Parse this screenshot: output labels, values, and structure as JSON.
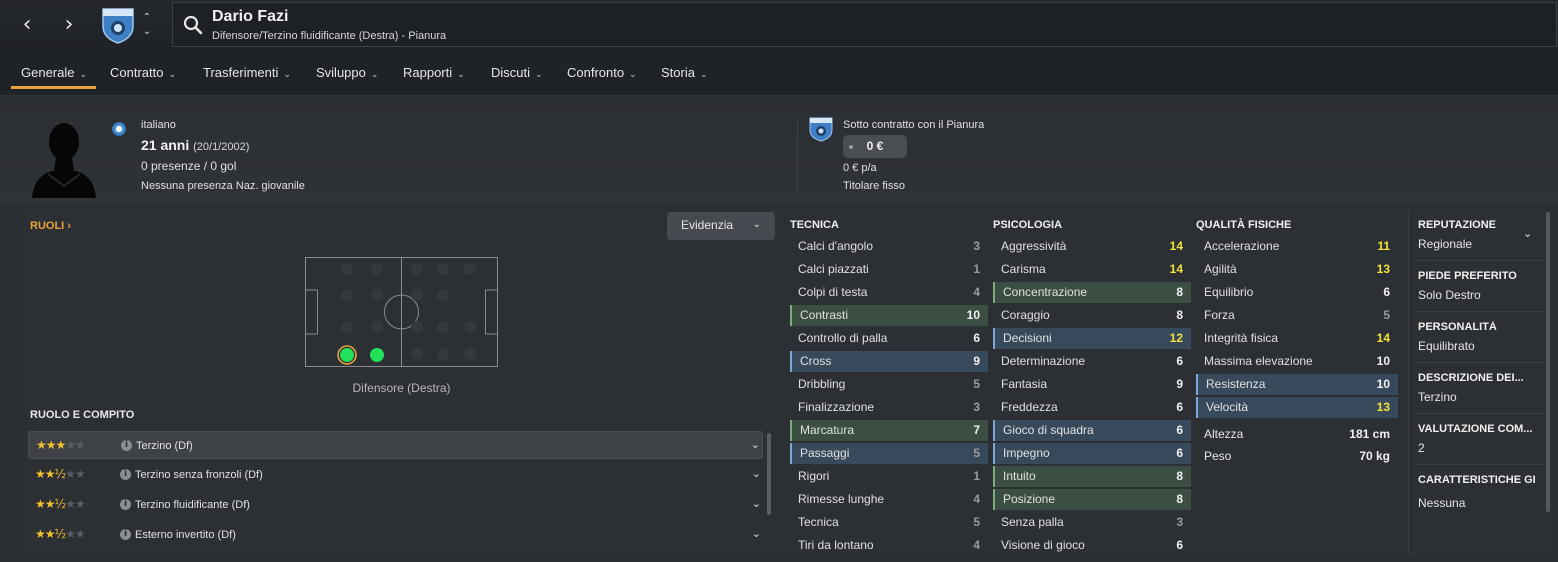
{
  "header": {
    "player_name": "Dario Fazi",
    "subtitle": "Difensore/Terzino fluidificante (Destra) - Pianura",
    "back_icon": "‹",
    "forward_icon": "›",
    "up_icon": "⌃",
    "down_icon": "⌄",
    "crest_text": "PIANURA"
  },
  "tabs": [
    {
      "label": "Generale"
    },
    {
      "label": "Contratto"
    },
    {
      "label": "Trasferimenti"
    },
    {
      "label": "Sviluppo"
    },
    {
      "label": "Rapporti"
    },
    {
      "label": "Discuti"
    },
    {
      "label": "Confronto"
    },
    {
      "label": "Storia"
    }
  ],
  "tab_chevron": "⌄",
  "profile": {
    "nationality": "italiano",
    "age": "21 anni",
    "dob": "(20/1/2002)",
    "apps": "0 presenze / 0 gol",
    "youth": "Nessuna presenza Naz. giovanile",
    "contract_text": "Sotto contratto con il Pianura",
    "wage_pill": "0 €",
    "wage_pa": "0 € p/a",
    "status": "Titolare fisso"
  },
  "roles": {
    "link": "RUOLI",
    "link_chevron": "›",
    "highlight_btn": "Evidenzia",
    "pitch_label": "Difensore (Destra)",
    "section_title": "RUOLO E COMPITO",
    "list": [
      {
        "name": "Terzino (Df)",
        "stars": "★★★",
        "empty": "★★",
        "rating": 3.0
      },
      {
        "name": "Terzino senza fronzoli (Df)",
        "stars": "★★½",
        "empty": "★★",
        "rating": 2.5
      },
      {
        "name": "Terzino fluidificante (Df)",
        "stars": "★★½",
        "empty": "★★",
        "rating": 2.5
      },
      {
        "name": "Esterno invertito (Df)",
        "stars": "★★½",
        "empty": "★★",
        "rating": 2.5
      }
    ],
    "info_glyph": "i",
    "row_chevron": "⌄"
  },
  "attributes": {
    "technical_title": "TECNICA",
    "mental_title": "PSICOLOGIA",
    "physical_title": "QUALITÀ FISICHE",
    "technical": [
      {
        "name": "Calci d'angolo",
        "value": "3"
      },
      {
        "name": "Calci piazzati",
        "value": "1"
      },
      {
        "name": "Colpi di testa",
        "value": "4"
      },
      {
        "name": "Contrasti",
        "value": "10"
      },
      {
        "name": "Controllo di palla",
        "value": "6"
      },
      {
        "name": "Cross",
        "value": "9"
      },
      {
        "name": "Dribbling",
        "value": "5"
      },
      {
        "name": "Finalizzazione",
        "value": "3"
      },
      {
        "name": "Marcatura",
        "value": "7"
      },
      {
        "name": "Passaggi",
        "value": "5"
      },
      {
        "name": "Rigori",
        "value": "1"
      },
      {
        "name": "Rimesse lunghe",
        "value": "4"
      },
      {
        "name": "Tecnica",
        "value": "5"
      },
      {
        "name": "Tiri da lontano",
        "value": "4"
      }
    ],
    "mental": [
      {
        "name": "Aggressività",
        "value": "14"
      },
      {
        "name": "Carisma",
        "value": "14"
      },
      {
        "name": "Concentrazione",
        "value": "8"
      },
      {
        "name": "Coraggio",
        "value": "8"
      },
      {
        "name": "Decisioni",
        "value": "12"
      },
      {
        "name": "Determinazione",
        "value": "6"
      },
      {
        "name": "Fantasia",
        "value": "9"
      },
      {
        "name": "Freddezza",
        "value": "6"
      },
      {
        "name": "Gioco di squadra",
        "value": "6"
      },
      {
        "name": "Impegno",
        "value": "6"
      },
      {
        "name": "Intuito",
        "value": "8"
      },
      {
        "name": "Posizione",
        "value": "8"
      },
      {
        "name": "Senza palla",
        "value": "3"
      },
      {
        "name": "Visione di gioco",
        "value": "6"
      }
    ],
    "physical": [
      {
        "name": "Accelerazione",
        "value": "11"
      },
      {
        "name": "Agilità",
        "value": "13"
      },
      {
        "name": "Equilibrio",
        "value": "6"
      },
      {
        "name": "Forza",
        "value": "5"
      },
      {
        "name": "Integrità fisica",
        "value": "14"
      },
      {
        "name": "Massima elevazione",
        "value": "10"
      },
      {
        "name": "Resistenza",
        "value": "10"
      },
      {
        "name": "Velocità",
        "value": "13"
      }
    ],
    "height_label": "Altezza",
    "height_value": "181 cm",
    "weight_label": "Peso",
    "weight_value": "70 kg"
  },
  "info_panel": {
    "items": [
      {
        "title": "REPUTAZIONE",
        "value": "Regionale"
      },
      {
        "title": "PIEDE PREFERITO",
        "value": "Solo Destro"
      },
      {
        "title": "PERSONALITÀ",
        "value": "Equilibrato"
      },
      {
        "title": "DESCRIZIONE DEI...",
        "value": "Terzino"
      },
      {
        "title": "VALUTAZIONE COM...",
        "value": "2"
      },
      {
        "title": "CARATTERISTICHE GI",
        "value": "Nessuna"
      }
    ],
    "chevron": "⌄"
  },
  "colors": {
    "accent": "#e8a33a",
    "highlight_green": "#3c4e42",
    "highlight_blue": "#374a5c",
    "value_yellow": "#f2e23a",
    "position_dot": "#22e05a"
  }
}
